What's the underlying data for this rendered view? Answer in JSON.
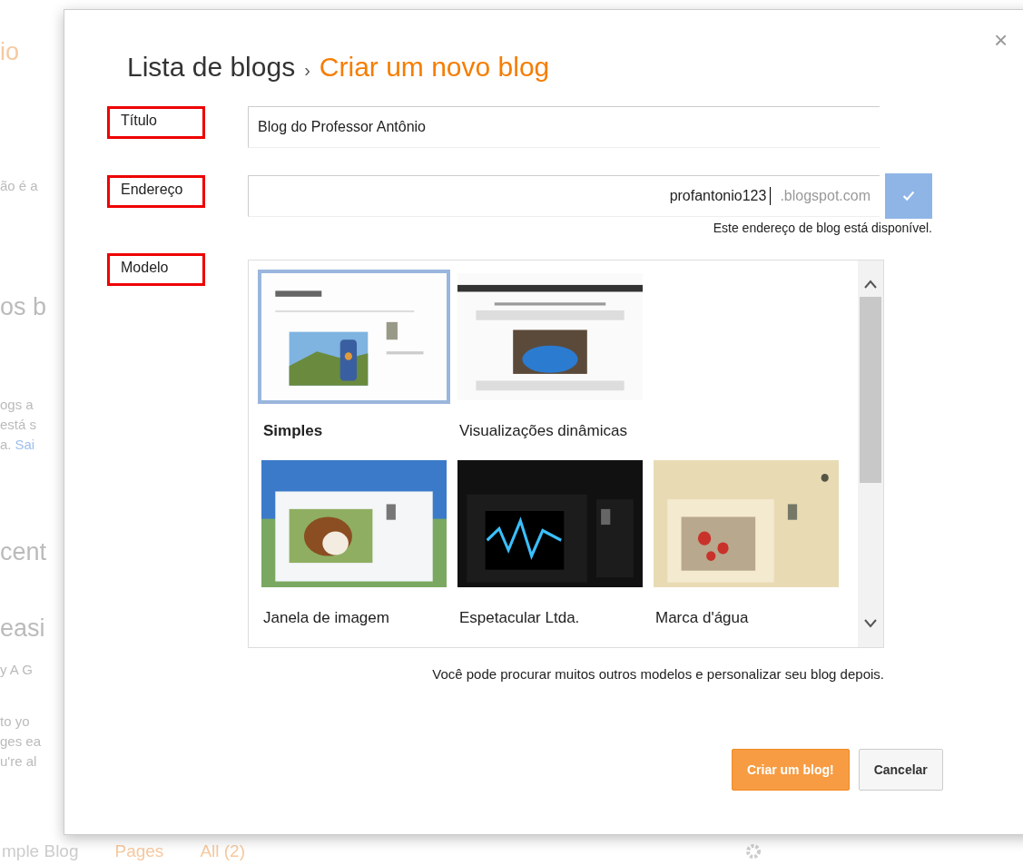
{
  "background": {
    "sections": [
      {
        "kind": "heading",
        "lines": [
          {
            "text": "io"
          }
        ]
      },
      {
        "kind": "body",
        "lines": [
          {
            "text": "ão é a"
          }
        ]
      },
      {
        "kind": "heading",
        "lines": [
          {
            "text": "os b"
          }
        ]
      },
      {
        "kind": "body",
        "lines": [
          {
            "text": "ogs a"
          },
          {
            "text": "está s"
          },
          {
            "text": "a.",
            "link": "Sai"
          }
        ]
      },
      {
        "kind": "heading",
        "lines": [
          {
            "text": "cent"
          }
        ]
      },
      {
        "kind": "heading",
        "lines": [
          {
            "text": "easi"
          }
        ]
      },
      {
        "kind": "body",
        "lines": [
          {
            "text": "y A G"
          }
        ]
      },
      {
        "kind": "body",
        "lines": [
          {
            "text": "to yo"
          },
          {
            "text": "ges ea"
          },
          {
            "text": "u're al"
          }
        ]
      }
    ],
    "bottom_bar": {
      "blog": "mple Blog",
      "links": [
        "Pages",
        "All (2)"
      ]
    }
  },
  "dialog": {
    "breadcrumb": {
      "parent": "Lista de blogs",
      "separator": "›",
      "current": "Criar um novo blog"
    },
    "close": "×",
    "fields": [
      {
        "label": "Título",
        "value": "Blog do Professor Antônio"
      },
      {
        "label": "Endereço",
        "value": "profantonio123",
        "suffix": ".blogspot.com",
        "available": true,
        "message": "Este endereço de blog está disponível."
      }
    ],
    "template": {
      "label": "Modelo",
      "options": [
        {
          "name": "Simples",
          "selected": true,
          "kind": "simple"
        },
        {
          "name": "Visualizações dinâmicas",
          "selected": false,
          "kind": "dynamic"
        },
        {
          "name": "Janela de imagem",
          "selected": false,
          "kind": "window"
        },
        {
          "name": "Espetacular Ltda.",
          "selected": false,
          "kind": "dark"
        },
        {
          "name": "Marca d'água",
          "selected": false,
          "kind": "watermark"
        }
      ],
      "note": "Você pode procurar muitos outros modelos e personalizar seu blog depois."
    },
    "buttons": [
      {
        "label": "Criar um blog!",
        "kind": "primary"
      },
      {
        "label": "Cancelar",
        "kind": "secondary"
      }
    ]
  }
}
